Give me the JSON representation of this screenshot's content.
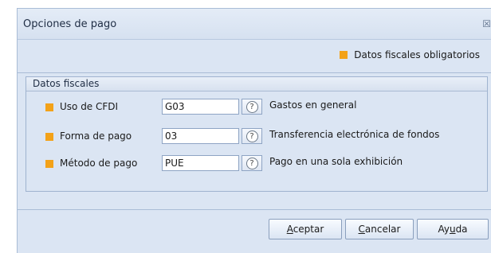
{
  "dialog": {
    "title": "Opciones de pago",
    "close_glyph": "☒",
    "legend_text": "Datos fiscales obligatorios"
  },
  "group": {
    "title": "Datos fiscales",
    "rows": [
      {
        "label": "Uso de CFDI",
        "value": "G03",
        "description": "Gastos en general"
      },
      {
        "label": "Forma de pago",
        "value": "03",
        "description": "Transferencia electrónica de fondos"
      },
      {
        "label": "Método de pago",
        "value": "PUE",
        "description": "Pago en una sola exhibición"
      }
    ]
  },
  "buttons": {
    "accept": {
      "underlined": "A",
      "rest": "ceptar"
    },
    "cancel": {
      "underlined": "C",
      "rest": "ancelar"
    },
    "help": {
      "pre": "Ay",
      "underlined": "u",
      "rest": "da"
    }
  },
  "colors": {
    "bullet": "#f3a219",
    "dialog_bg": "#dbe5f3",
    "border": "#a9bcd6"
  },
  "icons": {
    "help": "question-circle-icon",
    "close": "close-icon"
  }
}
